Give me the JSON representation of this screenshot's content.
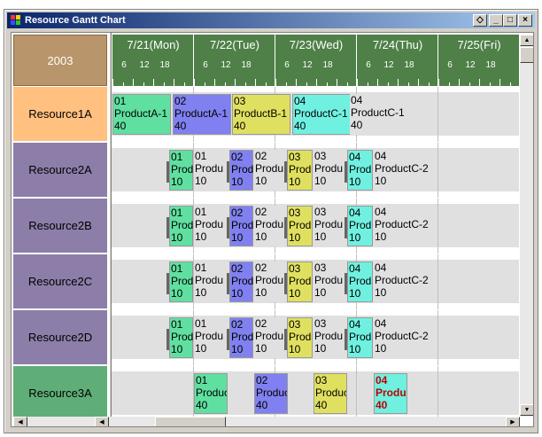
{
  "window": {
    "title": "Resource Gantt Chart",
    "btn_restore": "◇",
    "btn_min": "_",
    "btn_max": "□",
    "btn_close": "×"
  },
  "header": {
    "year": "2003",
    "days": [
      {
        "label": "7/21(Mon)",
        "hours": [
          "6",
          "12",
          "18"
        ]
      },
      {
        "label": "7/22(Tue)",
        "hours": [
          "6",
          "12",
          "18"
        ]
      },
      {
        "label": "7/23(Wed)",
        "hours": [
          "6",
          "12",
          "18"
        ]
      },
      {
        "label": "7/24(Thu)",
        "hours": [
          "6",
          "12",
          "18"
        ]
      },
      {
        "label": "7/25(Fri)",
        "hours": [
          "6",
          "12",
          "18"
        ]
      }
    ]
  },
  "resources": [
    {
      "name": "Resource1A",
      "color": "#ffc080"
    },
    {
      "name": "Resource2A",
      "color": "#8c7ea8"
    },
    {
      "name": "Resource2B",
      "color": "#8c7ea8"
    },
    {
      "name": "Resource2C",
      "color": "#8c7ea8"
    },
    {
      "name": "Resource2D",
      "color": "#8c7ea8"
    },
    {
      "name": "Resource3A",
      "color": "#5fae78"
    }
  ],
  "tasks_r1": [
    {
      "l1": "01",
      "l2": "ProductA-1",
      "l3": "40",
      "color": "#60e0a0"
    },
    {
      "l1": "02",
      "l2": "ProductA-1",
      "l3": "40",
      "color": "#8080f0"
    },
    {
      "l1": "03",
      "l2": "ProductB-1",
      "l3": "40",
      "color": "#e0e060"
    },
    {
      "l1": "04",
      "l2": "ProductC-1",
      "l3": "40",
      "color": "#70f0e0"
    },
    {
      "l1": "04",
      "l2": "ProductC-1",
      "l3": "40",
      "color": "#e0e0e0"
    }
  ],
  "tasks_r2": [
    {
      "l1": "01",
      "l2": "Prod",
      "l3": "10",
      "color": "#60e0a0"
    },
    {
      "l1": "01",
      "l2": "Produ",
      "l3": "10",
      "color": "#e0e0e0"
    },
    {
      "l1": "02",
      "l2": "Prod",
      "l3": "10",
      "color": "#8080f0"
    },
    {
      "l1": "02",
      "l2": "Produ",
      "l3": "10",
      "color": "#e0e0e0"
    },
    {
      "l1": "03",
      "l2": "Prod",
      "l3": "10",
      "color": "#e0e060"
    },
    {
      "l1": "03",
      "l2": "Produ",
      "l3": "10",
      "color": "#e0e0e0"
    },
    {
      "l1": "04",
      "l2": "Prod",
      "l3": "10",
      "color": "#70f0e0"
    },
    {
      "l1": "04",
      "l2": "ProductC-2",
      "l3": "10",
      "color": "#e0e0e0"
    }
  ],
  "tasks_r3": [
    {
      "l1": "01",
      "l2": "ProductA",
      "l3": "40",
      "color": "#60e0a0"
    },
    {
      "l1": "02",
      "l2": "ProductA",
      "l3": "40",
      "color": "#8080f0"
    },
    {
      "l1": "03",
      "l2": "ProductB",
      "l3": "40",
      "color": "#e0e060"
    },
    {
      "l1": "04",
      "l2": "ProductC",
      "l3": "40",
      "color": "#70f0e0",
      "highlight": true
    }
  ],
  "scroll": {
    "up": "▲",
    "down": "▼",
    "left": "◀",
    "right": "▶"
  }
}
